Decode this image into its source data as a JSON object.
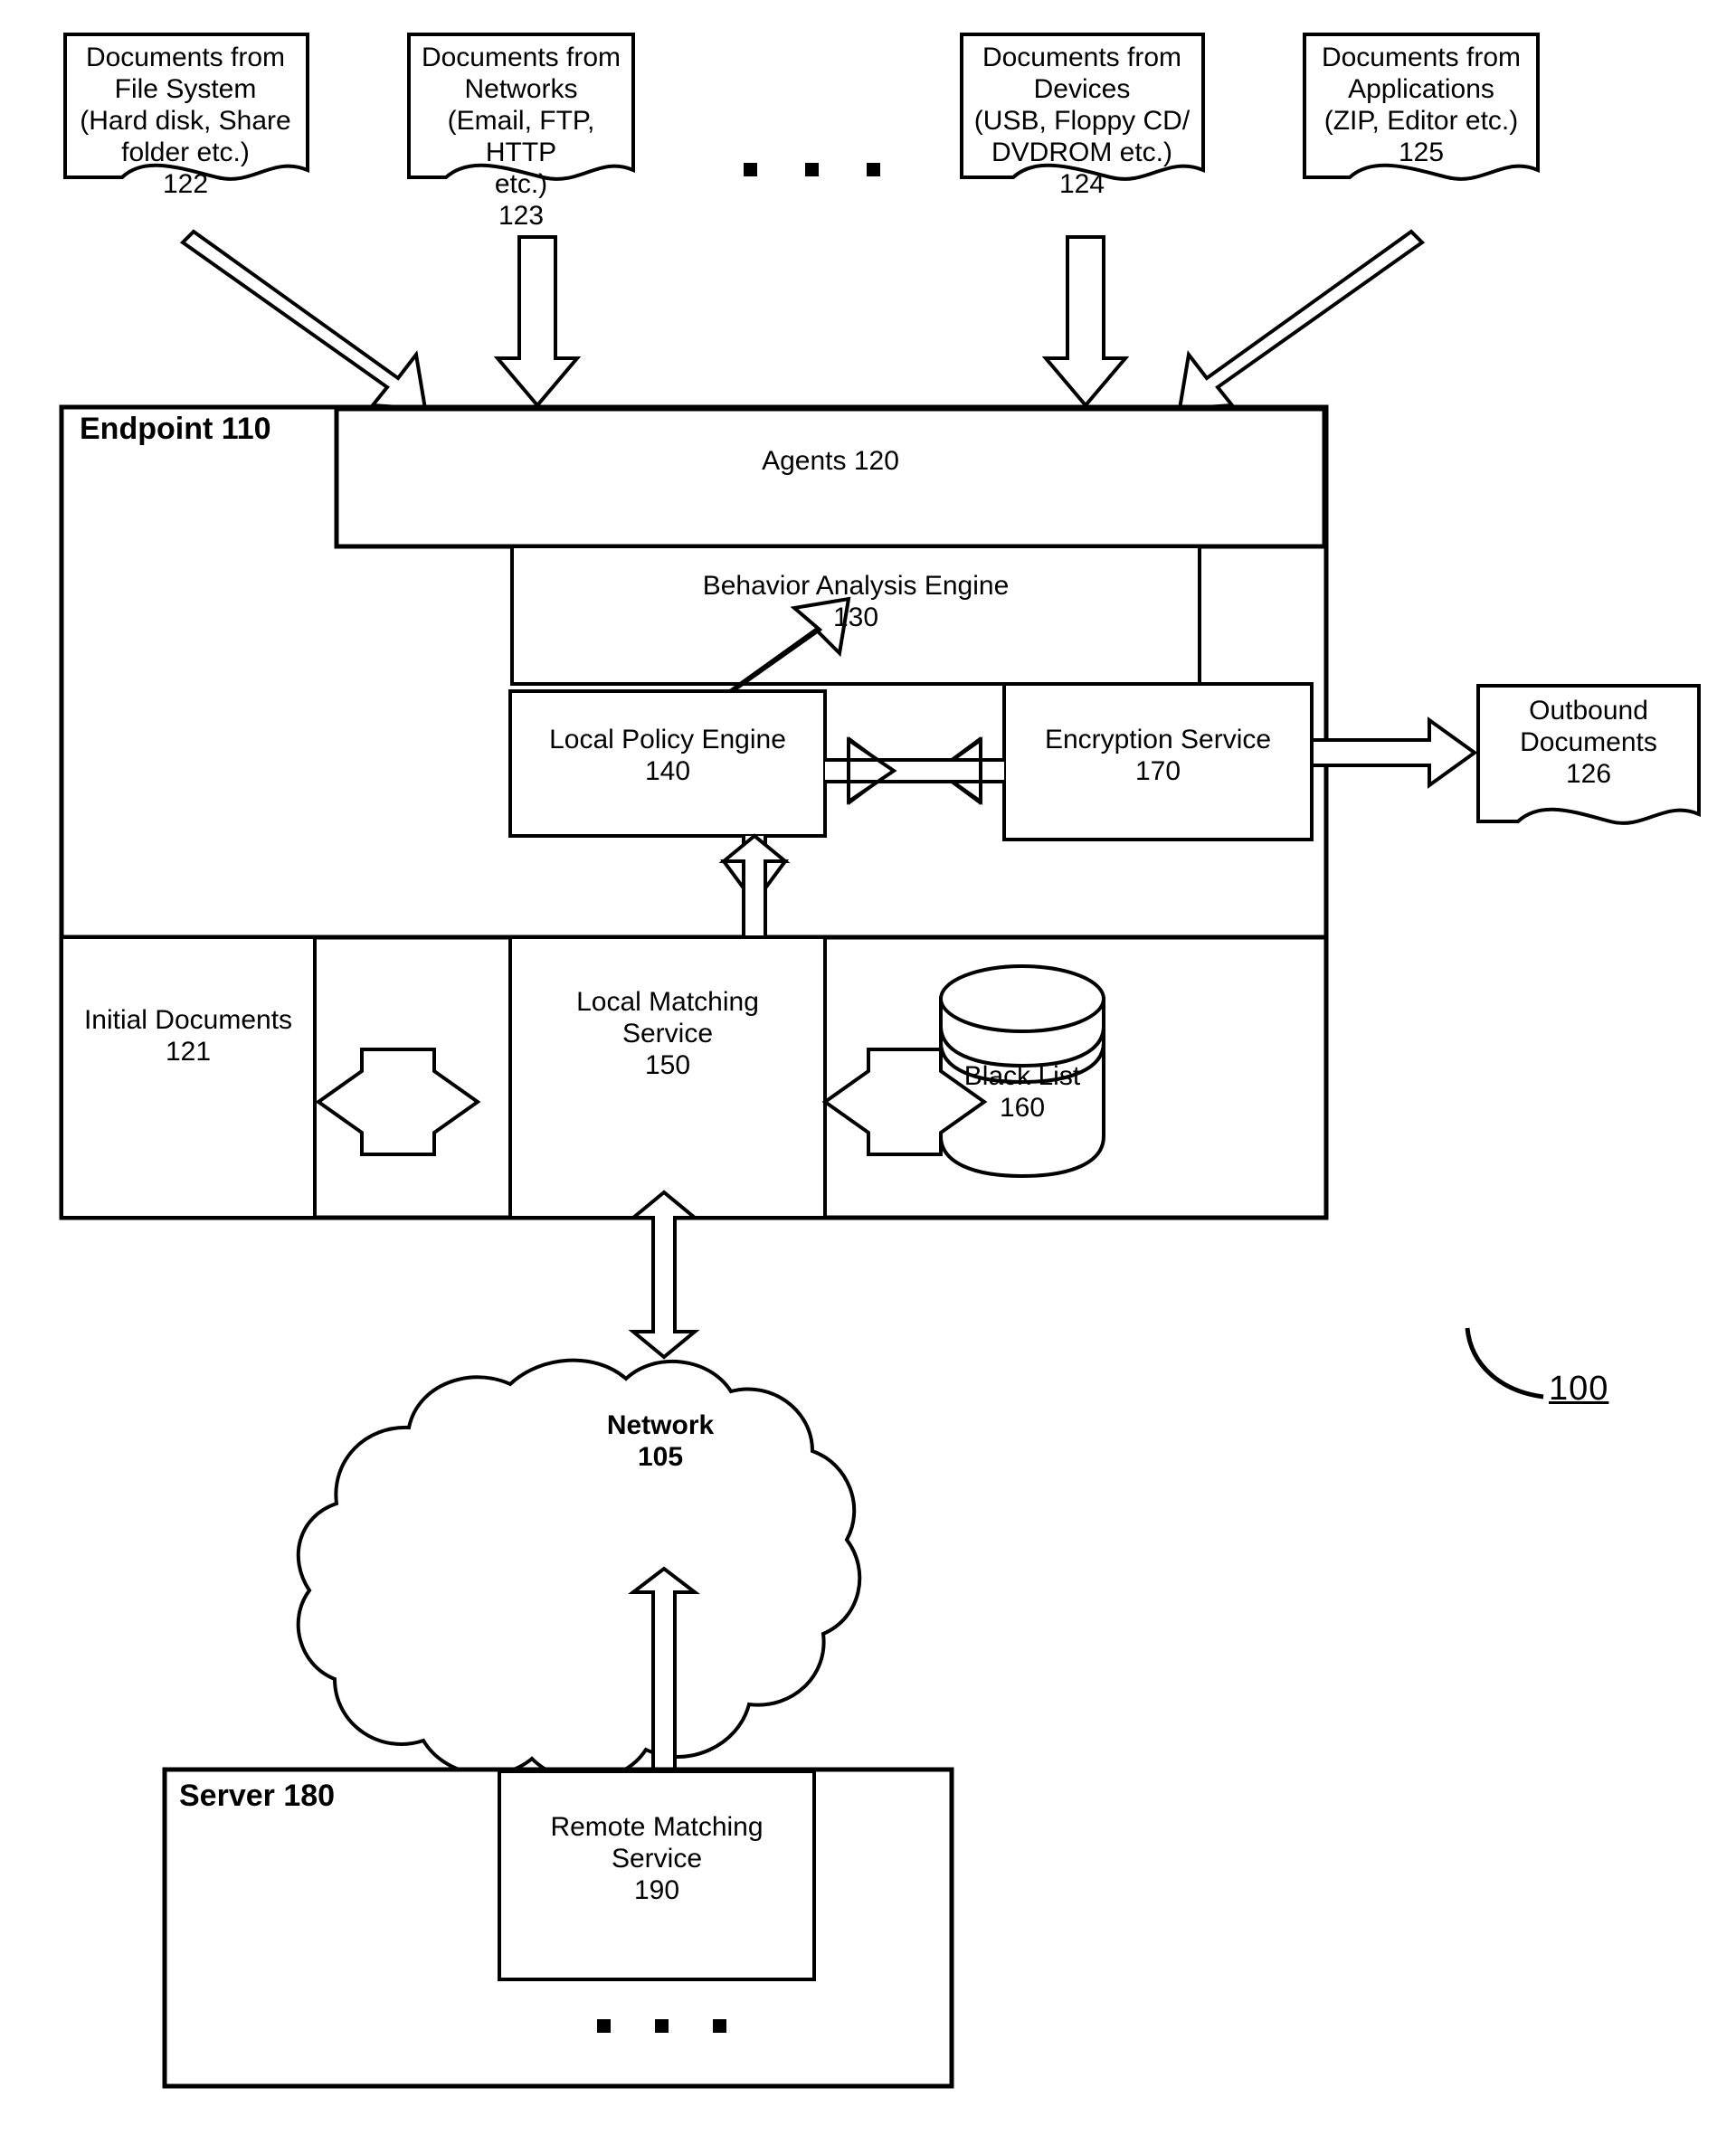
{
  "figure": {
    "reference_numeral": "100"
  },
  "sources": [
    {
      "id": "doc-file-system",
      "text": "Documents from\nFile System\n(Hard disk, Share\nfolder etc.)\n122",
      "numeral": "122"
    },
    {
      "id": "doc-networks",
      "text": "Documents from\nNetworks\n(Email, FTP, HTTP\netc.)\n123",
      "numeral": "123"
    },
    {
      "id": "doc-devices",
      "text": "Documents from\nDevices\n(USB, Floppy CD/\nDVDROM etc.)\n124",
      "numeral": "124"
    },
    {
      "id": "doc-applications",
      "text": "Documents from\nApplications\n(ZIP, Editor etc.)\n125",
      "numeral": "125"
    }
  ],
  "endpoint": {
    "title": "Endpoint 110",
    "agents": "Agents 120",
    "behavior_analysis_engine": "Behavior Analysis Engine\n130",
    "local_policy_engine": "Local Policy Engine\n140",
    "encryption_service": "Encryption Service\n170",
    "initial_documents": "Initial Documents\n121",
    "local_matching_service": "Local Matching\nService\n150",
    "black_list": "Black List\n160"
  },
  "outbound": {
    "label": "Outbound\nDocuments\n126"
  },
  "network": {
    "label": "Network\n105"
  },
  "server": {
    "title": "Server 180",
    "remote_matching_service": "Remote Matching\nService\n190"
  },
  "colors": {
    "stroke": "#000000",
    "fill": "#ffffff"
  }
}
